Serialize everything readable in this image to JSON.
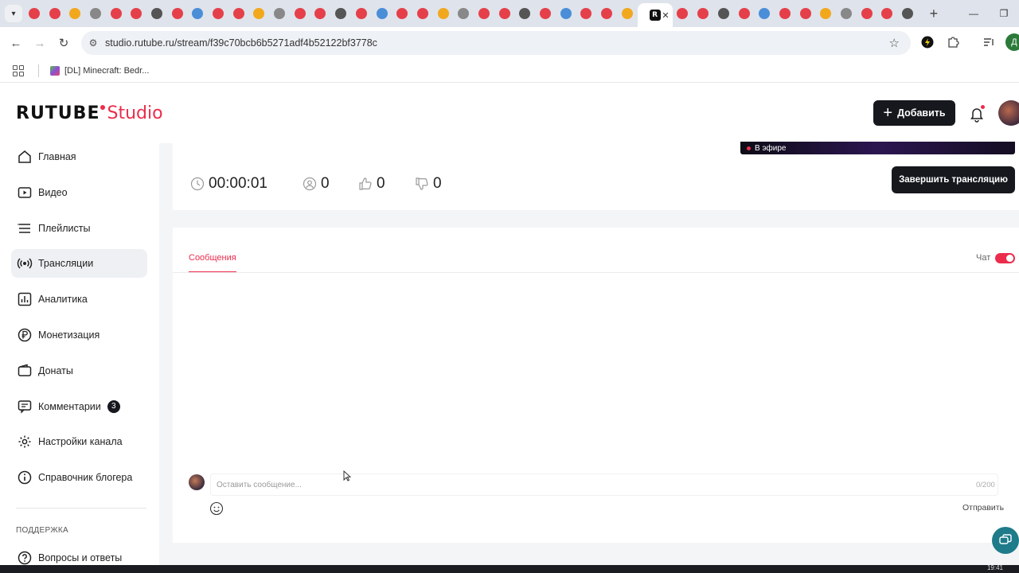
{
  "browser": {
    "tab_count_before_active": 30,
    "tab_count_after_active": 12,
    "active_tab_close": "✕",
    "new_tab": "+",
    "url": "studio.rutube.ru/stream/f39c70bcb6b5271adf4b52122bf3778c",
    "bookmark": "[DL] Minecraft: Bedr...",
    "profile_letter": "Д"
  },
  "header": {
    "logo_main": "RUTUBE",
    "logo_accent": "Studio",
    "add_button": "Добавить"
  },
  "sidebar": {
    "items": [
      {
        "label": "Главная",
        "icon": "home-icon"
      },
      {
        "label": "Видео",
        "icon": "video-icon"
      },
      {
        "label": "Плейлисты",
        "icon": "playlist-icon"
      },
      {
        "label": "Трансляции",
        "icon": "broadcast-icon",
        "active": true
      },
      {
        "label": "Аналитика",
        "icon": "analytics-icon"
      },
      {
        "label": "Монетизация",
        "icon": "ruble-icon"
      },
      {
        "label": "Донаты",
        "icon": "wallet-icon"
      },
      {
        "label": "Комментарии",
        "icon": "comment-icon",
        "count": "3"
      },
      {
        "label": "Настройки канала",
        "icon": "gear-icon"
      },
      {
        "label": "Справочник блогера",
        "icon": "info-icon"
      }
    ],
    "support_title": "ПОДДЕРЖКА",
    "support_items": [
      {
        "label": "Вопросы и ответы",
        "icon": "question-icon"
      }
    ]
  },
  "stream": {
    "live_label": "В эфире",
    "duration": "00:00:01",
    "viewers": "0",
    "likes": "0",
    "dislikes": "0",
    "end_button": "Завершить трансляцию"
  },
  "chat": {
    "tab_label": "Сообщения",
    "toggle_label": "Чат",
    "toggle_on": true,
    "input_placeholder": "Оставить сообщение...",
    "char_count": "0/200",
    "send_label": "Отправить"
  },
  "taskbar": {
    "clock": "19:41"
  },
  "colors": {
    "accent": "#ec2c4c",
    "dark_button": "#16181d",
    "help_fab": "#1e7b8a"
  }
}
